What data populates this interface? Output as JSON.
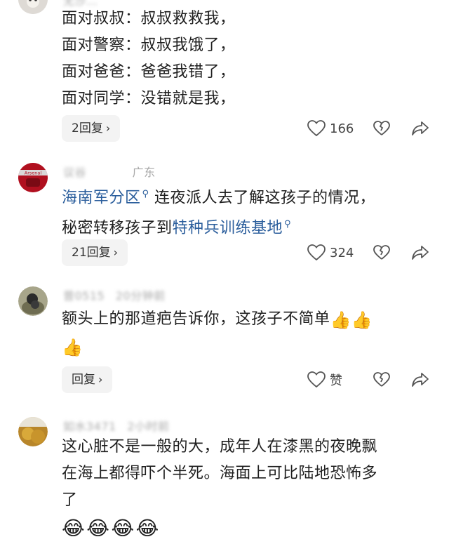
{
  "comments": [
    {
      "meta_name": "无沙…",
      "meta_time": "",
      "lines": [
        "面对叔叔：叔叔救救我，",
        "面对警察：叔叔我饿了，",
        "面对爸爸：爸爸我错了，",
        "面对同学：没错就是我，"
      ],
      "reply_label": "2回复",
      "like_count": "166"
    },
    {
      "meta_name": "",
      "meta_time": "广东",
      "avatar_text": "Arsenal",
      "line1_link": "海南军分区",
      "line1_rest": "连夜派人去了解这孩子的情况，",
      "line2_pre": "秘密转移孩子到",
      "line2_link": "特种兵训练基地",
      "reply_label": "21回复",
      "like_count": "324"
    },
    {
      "meta_name": "曾0515",
      "meta_time": "20分钟前",
      "text": "额头上的那道疤告诉你，这孩子不简单",
      "reply_label": "回复",
      "like_count": "赞"
    },
    {
      "meta_name": "如水3471",
      "meta_time": "2小时前",
      "lines": [
        "这心脏不是一般的大，成年人在漆黑的夜晚飘",
        "在海上都得吓个半死。海面上可比陆地恐怖多",
        "了"
      ]
    }
  ],
  "icons": {
    "like": "heart-outline-icon",
    "dislike": "broken-heart-icon",
    "share": "share-arrow-icon",
    "thumbs": "thumbs-up-emoji",
    "laugh": "laughing-tears-emoji",
    "search": "search-icon"
  },
  "colors": {
    "link": "#2b5e9c",
    "meta": "#a8a8a8",
    "button_bg": "#f3f3f3"
  }
}
